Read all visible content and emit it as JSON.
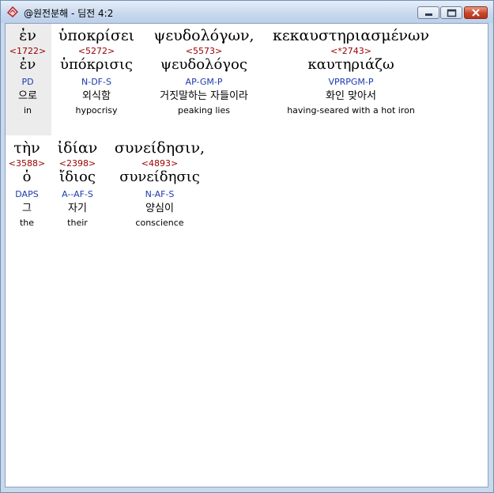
{
  "window": {
    "title": "@원전분해 - 딤전 4:2"
  },
  "lines": [
    {
      "words": [
        {
          "greek": "ἐν",
          "strong": "<1722>",
          "lemma": "ἐν",
          "morph": "PD",
          "korean": "으로",
          "english": "in"
        },
        {
          "greek": "ὑποκρίσει",
          "strong": "<5272>",
          "lemma": "ὑπόκρισις",
          "morph": "N-DF-S",
          "korean": "외식함",
          "english": "hypocrisy"
        },
        {
          "greek": "ψευδολόγων,",
          "strong": "<5573>",
          "lemma": "ψευδολόγος",
          "morph": "AP-GM-P",
          "korean": "거짓말하는 자들이라",
          "english": "peaking lies"
        },
        {
          "greek": "κεκαυστηριασμένων",
          "strong": "<*2743>",
          "lemma": "καυτηριάζω",
          "morph": "VPRPGM-P",
          "korean": "화인 맞아서",
          "english": "having-seared with a hot iron"
        }
      ]
    },
    {
      "words": [
        {
          "greek": "τὴν",
          "strong": "<3588>",
          "lemma": "ὁ",
          "morph": "DAPS",
          "korean": "그",
          "english": "the"
        },
        {
          "greek": "ἰδίαν",
          "strong": "<2398>",
          "lemma": "ἴδιος",
          "morph": "A--AF-S",
          "korean": "자기",
          "english": "their"
        },
        {
          "greek": "συνείδησιν,",
          "strong": "<4893>",
          "lemma": "συνείδησις",
          "morph": "N-AF-S",
          "korean": "양심이",
          "english": "conscience"
        }
      ]
    }
  ]
}
